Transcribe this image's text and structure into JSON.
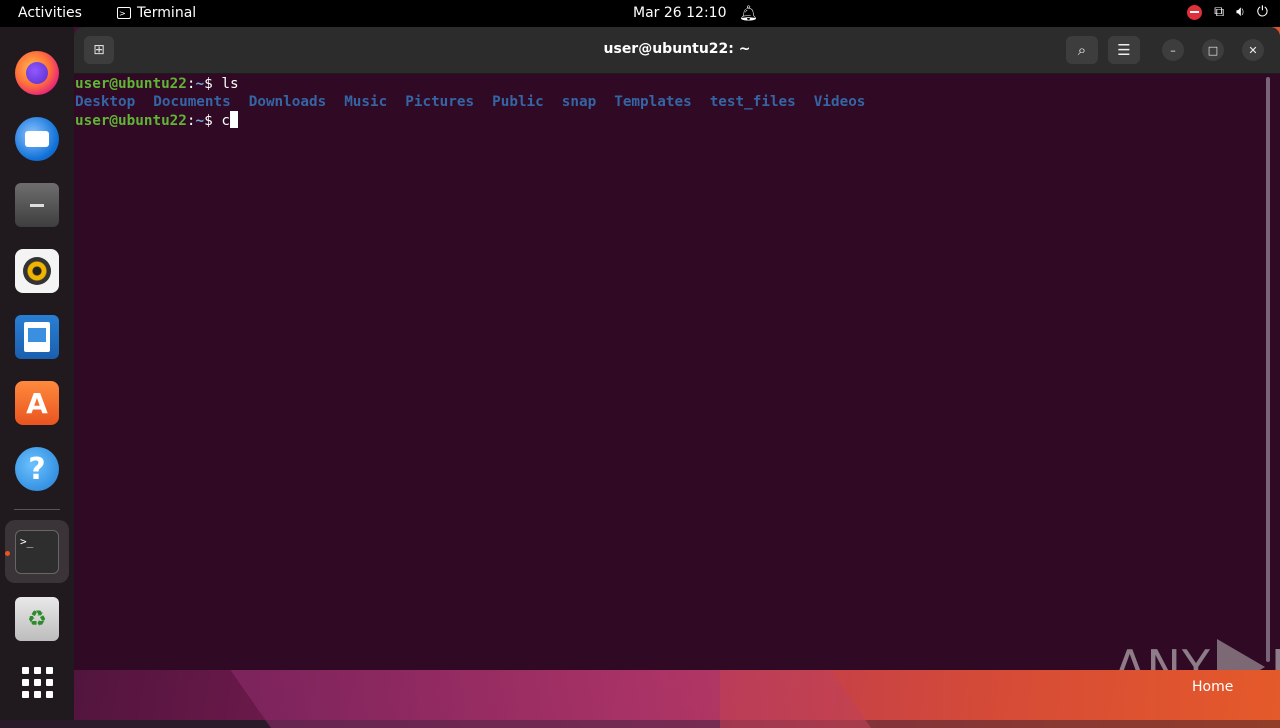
{
  "topbar": {
    "activities": "Activities",
    "app_name": "Terminal",
    "clock": "Mar 26  12:10"
  },
  "dock": {
    "items": [
      "firefox",
      "thunderbird",
      "files",
      "rhythmbox",
      "libreoffice-writer",
      "app-center",
      "help",
      "terminal",
      "trash",
      "show-applications"
    ],
    "terminal_glyph": ">_"
  },
  "window": {
    "title": "user@ubuntu22: ~"
  },
  "terminal": {
    "prompt_user": "user@ubuntu22",
    "prompt_sep": ":",
    "prompt_path": "~",
    "prompt_end": "$ ",
    "cmd1": "ls",
    "dirs": [
      "Desktop",
      "Documents",
      "Downloads",
      "Music",
      "Pictures",
      "Public",
      "snap",
      "Templates",
      "test_files",
      "Videos"
    ],
    "cmd2": "c"
  },
  "desktop": {
    "home_label": "Home",
    "watermark": "ANY RUN"
  },
  "colors": {
    "terminal_bg": "#300a24",
    "prompt_user": "#5fb534",
    "directory": "#3465a4",
    "accent": "#e95420"
  }
}
